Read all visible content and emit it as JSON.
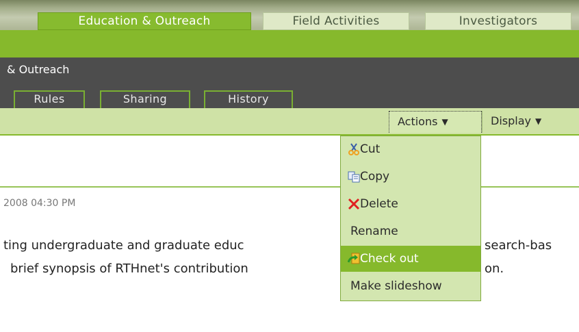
{
  "top_tabs": [
    {
      "label": "Education & Outreach",
      "active": true
    },
    {
      "label": "Field Activities",
      "active": false
    },
    {
      "label": "Investigators",
      "active": false
    }
  ],
  "breadcrumb_title": "& Outreach",
  "sub_tabs": [
    "Rules",
    "Sharing",
    "History"
  ],
  "toolbar": {
    "actions_label": "Actions",
    "display_label": "Display",
    "dropdown_arrow": "▼"
  },
  "post": {
    "date": "2008 04:30 PM",
    "line1_left": "ting undergraduate and graduate educ",
    "line1_right": "search-bas",
    "line2_left": "brief synopsis of RTHnet's contribution",
    "line2_right": "on."
  },
  "menu": {
    "items": [
      {
        "label": "Cut",
        "icon": "scissors-icon"
      },
      {
        "label": "Copy",
        "icon": "copy-icon"
      },
      {
        "label": "Delete",
        "icon": "delete-x-icon"
      },
      {
        "label": "Rename",
        "icon": ""
      },
      {
        "label": "Check out",
        "icon": "check-out-icon",
        "highlighted": true
      },
      {
        "label": "Make slideshow",
        "icon": ""
      }
    ]
  },
  "colors": {
    "brand_green": "#86b92c",
    "menu_bg": "#d3e6b0",
    "dark_bar": "#4d4d4d",
    "delete_red": "#e02020"
  }
}
